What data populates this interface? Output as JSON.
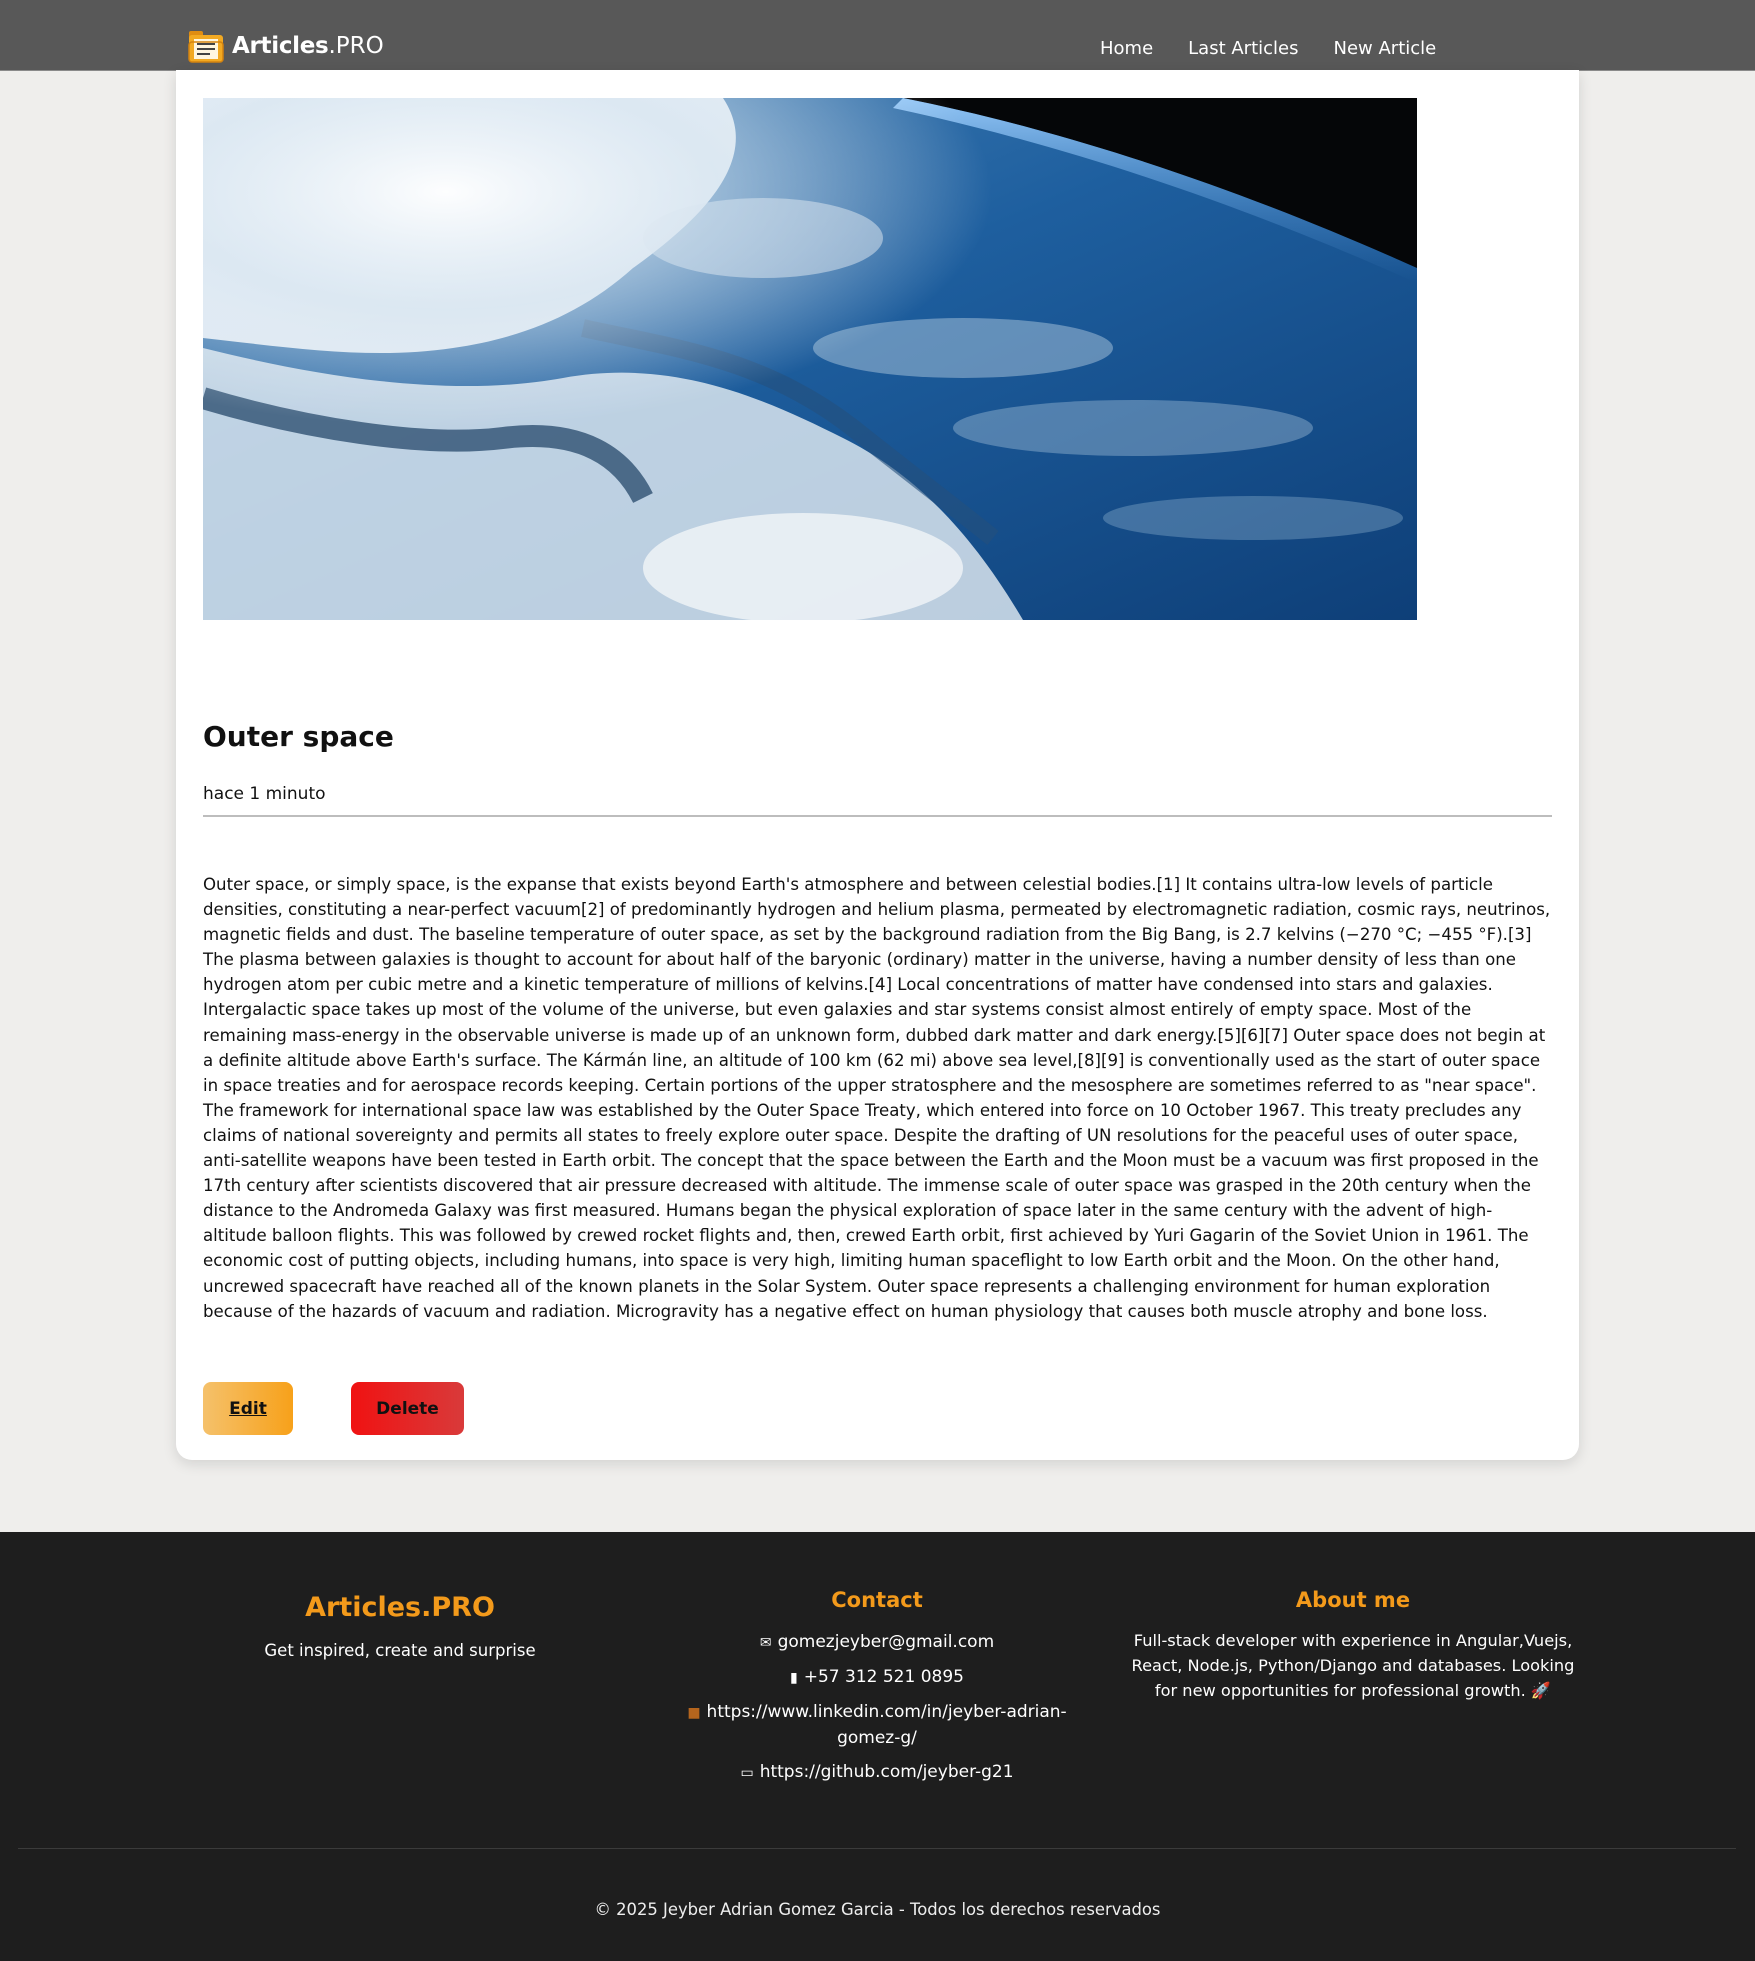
{
  "header": {
    "brand_strong": "Articles",
    "brand_suffix": ".PRO",
    "nav": [
      "Home",
      "Last Articles",
      "New Article"
    ]
  },
  "article": {
    "title": "Outer space",
    "time": "hace 1 minuto",
    "body": "Outer space, or simply space, is the expanse that exists beyond Earth's atmosphere and between celestial bodies.[1] It contains ultra-low levels of particle densities, constituting a near-perfect vacuum[2] of predominantly hydrogen and helium plasma, permeated by electromagnetic radiation, cosmic rays, neutrinos, magnetic fields and dust. The baseline temperature of outer space, as set by the background radiation from the Big Bang, is 2.7 kelvins (−270 °C; −455 °F).[3] The plasma between galaxies is thought to account for about half of the baryonic (ordinary) matter in the universe, having a number density of less than one hydrogen atom per cubic metre and a kinetic temperature of millions of kelvins.[4] Local concentrations of matter have condensed into stars and galaxies. Intergalactic space takes up most of the volume of the universe, but even galaxies and star systems consist almost entirely of empty space. Most of the remaining mass-energy in the observable universe is made up of an unknown form, dubbed dark matter and dark energy.[5][6][7] Outer space does not begin at a definite altitude above Earth's surface. The Kármán line, an altitude of 100 km (62 mi) above sea level,[8][9] is conventionally used as the start of outer space in space treaties and for aerospace records keeping. Certain portions of the upper stratosphere and the mesosphere are sometimes referred to as \"near space\". The framework for international space law was established by the Outer Space Treaty, which entered into force on 10 October 1967. This treaty precludes any claims of national sovereignty and permits all states to freely explore outer space. Despite the drafting of UN resolutions for the peaceful uses of outer space, anti-satellite weapons have been tested in Earth orbit. The concept that the space between the Earth and the Moon must be a vacuum was first proposed in the 17th century after scientists discovered that air pressure decreased with altitude. The immense scale of outer space was grasped in the 20th century when the distance to the Andromeda Galaxy was first measured. Humans began the physical exploration of space later in the same century with the advent of high-altitude balloon flights. This was followed by crewed rocket flights and, then, crewed Earth orbit, first achieved by Yuri Gagarin of the Soviet Union in 1961. The economic cost of putting objects, including humans, into space is very high, limiting human spaceflight to low Earth orbit and the Moon. On the other hand, uncrewed spacecraft have reached all of the known planets in the Solar System. Outer space represents a challenging environment for human exploration because of the hazards of vacuum and radiation. Microgravity has a negative effect on human physiology that causes both muscle atrophy and bone loss.",
    "edit_label": "Edit",
    "delete_label": "Delete"
  },
  "footer": {
    "brand": "Articles.PRO",
    "tagline": "Get inspired, create and surprise",
    "contact_heading": "Contact",
    "contact": {
      "email": "gomezjeyber@gmail.com",
      "phone": "+57 312 521 0895",
      "linkedin": "https://www.linkedin.com/in/jeyber-adrian-gomez-g/",
      "github": "https://github.com/jeyber-g21"
    },
    "about_heading": "About me",
    "about": "Full-stack developer with experience in Angular,Vuejs, React, Node.js, Python/Django and databases. Looking for new opportunities for professional growth. 🚀",
    "copyright": "© 2025 Jeyber Adrian Gomez Garcia - Todos los derechos reservados"
  },
  "colors": {
    "header_bg": "#585858",
    "footer_bg": "#1e1e1e",
    "accent": "#f39a1b",
    "edit_button": "#f7a11a",
    "delete_button": "#f01212"
  },
  "icons": {
    "brand": "folder-document-icon",
    "email": "envelope-icon",
    "phone": "mobile-phone-icon",
    "linkedin": "briefcase-icon",
    "github": "laptop-icon"
  }
}
